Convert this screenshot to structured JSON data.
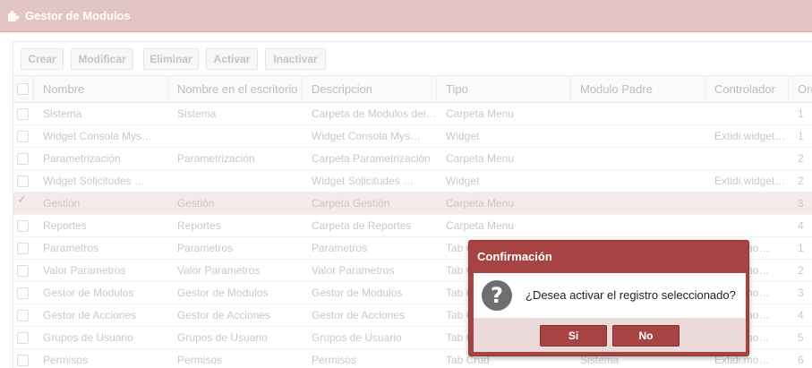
{
  "window": {
    "title": "Gestor de Modulos",
    "icon": "puzzle-icon",
    "accent_color": "#a84343",
    "titlebar_color": "#e4c5c5"
  },
  "toolbar": {
    "crear": "Crear",
    "modificar": "Modificar",
    "eliminar": "Eliminar",
    "activar": "Activar",
    "inactivar": "Inactivar"
  },
  "grid": {
    "columns": [
      "Nombre",
      "Nombre en el escritorio",
      "Descripcion",
      "Tipo",
      "Modulo Padre",
      "Controlador",
      "Orden"
    ],
    "rows": [
      {
        "nombre": "Sistema",
        "escritorio": "Sistema",
        "descripcion": "Carpeta de Modulos del Sistema",
        "tipo": "Carpeta Menu",
        "padre": "",
        "controlador": "",
        "orden": "1",
        "selected": false
      },
      {
        "nombre": "Widget Consola Mys…",
        "escritorio": "",
        "descripcion": "Widget Consola Mys…",
        "tipo": "Widget",
        "padre": "",
        "controlador": "Extidi.widget…",
        "orden": "1",
        "selected": false
      },
      {
        "nombre": "Parametrización",
        "escritorio": "Parametrización",
        "descripcion": "Carpeta Parametrización",
        "tipo": "Carpeta Menu",
        "padre": "",
        "controlador": "",
        "orden": "2",
        "selected": false
      },
      {
        "nombre": "Widget Solicitudes …",
        "escritorio": "",
        "descripcion": "Widget Solicitudes …",
        "tipo": "Widget",
        "padre": "",
        "controlador": "Extidi.widget…",
        "orden": "2",
        "selected": false
      },
      {
        "nombre": "Gestión",
        "escritorio": "Gestión",
        "descripcion": "Carpeta Gestión",
        "tipo": "Carpeta Menu",
        "padre": "",
        "controlador": "",
        "orden": "3",
        "selected": true
      },
      {
        "nombre": "Reportes",
        "escritorio": "Reportes",
        "descripcion": "Carpeta de Reportes",
        "tipo": "Carpeta Menu",
        "padre": "",
        "controlador": "",
        "orden": "4",
        "selected": false
      },
      {
        "nombre": "Parametros",
        "escritorio": "Parametros",
        "descripcion": "Parametros",
        "tipo": "Tab Crud",
        "padre": "",
        "controlador": "Extidi.mo…",
        "orden": "1",
        "selected": false
      },
      {
        "nombre": "Valor Parametros",
        "escritorio": "Valor Parametros",
        "descripcion": "Valor Parametros",
        "tipo": "Tab Crud",
        "padre": "",
        "controlador": "Extidi.mo…",
        "orden": "2",
        "selected": false
      },
      {
        "nombre": "Gestor de Modulos",
        "escritorio": "Gestor de Modulos",
        "descripcion": "Gestor de Modulos",
        "tipo": "Tab Crud",
        "padre": "",
        "controlador": "Extidi.mo…",
        "orden": "3",
        "selected": false
      },
      {
        "nombre": "Gestor de Acciones",
        "escritorio": "Gestor de Acciones",
        "descripcion": "Gestor de Acciones",
        "tipo": "Tab Crud",
        "padre": "",
        "controlador": "Extidi.mo…",
        "orden": "4",
        "selected": false
      },
      {
        "nombre": "Grupos de Usuario",
        "escritorio": "Grupos de Usuario",
        "descripcion": "Grupos de Usuario",
        "tipo": "Tab Crud",
        "padre": "",
        "controlador": "Extidi.mo…",
        "orden": "5",
        "selected": false
      },
      {
        "nombre": "Permisos",
        "escritorio": "Permisos",
        "descripcion": "Permisos",
        "tipo": "Tab Crud",
        "padre": "Sistema",
        "controlador": "Extidi.mo…",
        "orden": "6",
        "selected": false
      }
    ]
  },
  "dialog": {
    "title": "Confirmación",
    "icon": "question-icon",
    "message": "¿Desea activar el registro seleccionado?",
    "yes_label": "Si",
    "no_label": "No"
  }
}
